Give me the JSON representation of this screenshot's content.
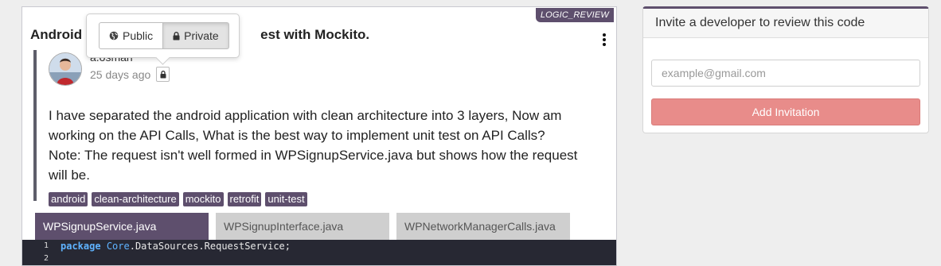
{
  "post": {
    "badge": "LOGIC_REVIEW",
    "title_left": "Android",
    "title_right": "est with Mockito.",
    "author": "a.osman",
    "time": "25 days ago",
    "body_lines": [
      "I have separated the android application with clean architecture into 3 layers,   Now am",
      "working on the API Calls, What is the best way to implement unit test on API Calls?",
      "Note: The request isn't well formed in WPSignupService.java but shows how the request",
      "will be."
    ],
    "tags": [
      "android",
      "clean-architecture",
      "mockito",
      "retrofit",
      "unit-test"
    ]
  },
  "visibility_popover": {
    "public_label": "Public",
    "private_label": "Private",
    "selected": "Private"
  },
  "files": {
    "tabs": [
      "WPSignupService.java",
      "WPSignupInterface.java",
      "WPNetworkManagerCalls.java"
    ],
    "active": 0
  },
  "code": {
    "lines": [
      {
        "number": "1",
        "keyword": "package",
        "package_root": "Core",
        "rest": ".DataSources.RequestService;"
      },
      {
        "number": "2",
        "keyword": "",
        "package_root": "",
        "rest": ""
      }
    ]
  },
  "invite": {
    "heading": "Invite a developer to review this code",
    "email_placeholder": "example@gmail.com",
    "button_label": "Add Invitation",
    "button_color": "#e88c8a"
  },
  "colors": {
    "accent": "#5e4f6d",
    "code_bg": "#272833"
  }
}
